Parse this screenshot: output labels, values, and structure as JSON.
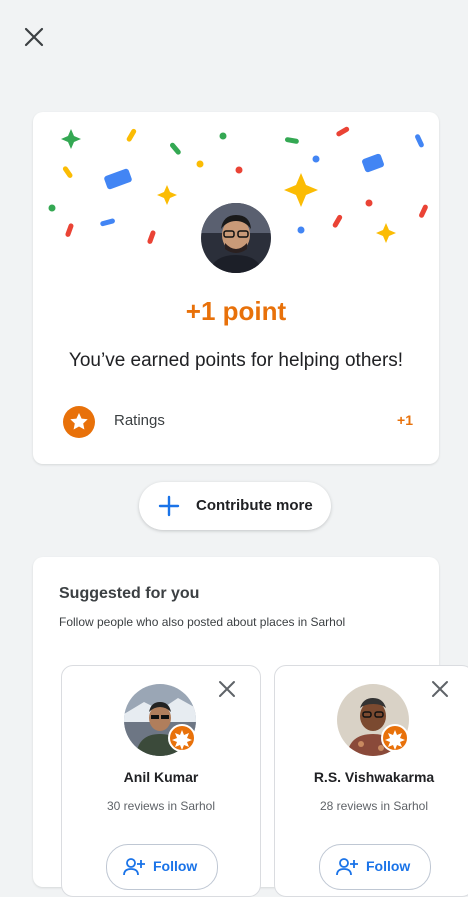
{
  "header": {
    "close_icon": "close-icon"
  },
  "points_card": {
    "title": "+1 point",
    "subtitle": "You’ve earned points for helping others!",
    "ratings": {
      "label": "Ratings",
      "value": "+1",
      "icon": "star-badge-icon"
    }
  },
  "contribute": {
    "label": "Contribute more",
    "icon": "plus-icon"
  },
  "suggested": {
    "title": "Suggested for you",
    "subtitle": "Follow people who also posted about places in Sarhol",
    "people": [
      {
        "name": "Anil Kumar",
        "reviews": "30 reviews in Sarhol",
        "follow_label": "Follow"
      },
      {
        "name": "R.S. Vishwakarma",
        "reviews": "28 reviews in Sarhol",
        "follow_label": "Follow"
      }
    ]
  },
  "colors": {
    "accent": "#e8710a",
    "link": "#1a73e8",
    "background": "#f1f3f4"
  }
}
